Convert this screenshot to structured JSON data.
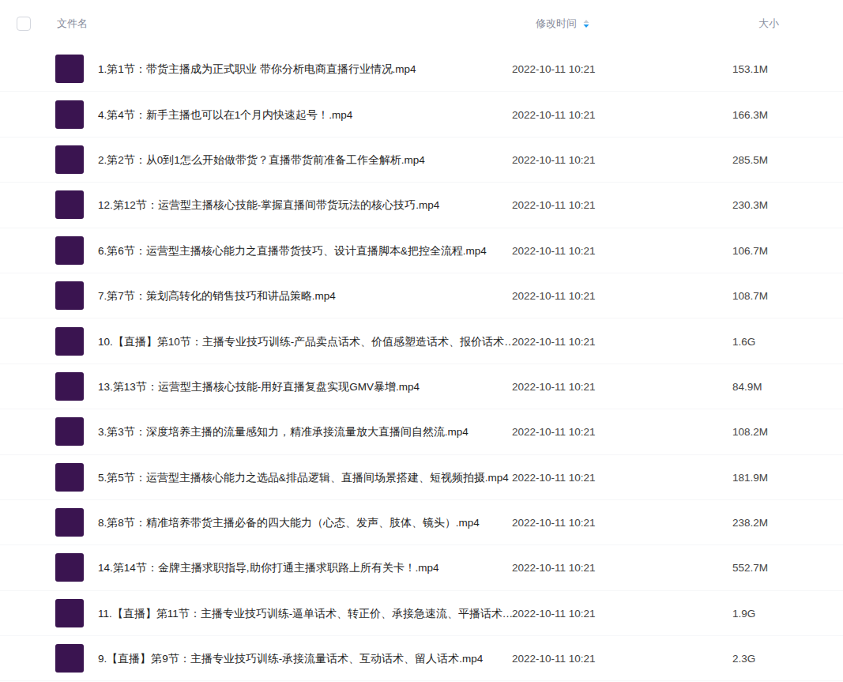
{
  "header": {
    "select_all": {
      "checked": false
    },
    "columns": [
      {
        "label": "文件名",
        "sorted": false
      },
      {
        "label": "修改时间",
        "sorted": true
      },
      {
        "label": "大小",
        "sorted": false
      }
    ]
  },
  "files": [
    {
      "name": "1.第1节：带货主播成为正式职业 带你分析电商直播行业情况.mp4",
      "modified": "2022-10-11 10:21",
      "size": "153.1M"
    },
    {
      "name": "4.第4节：新手主播也可以在1个月内快速起号！.mp4",
      "modified": "2022-10-11 10:21",
      "size": "166.3M"
    },
    {
      "name": "2.第2节：从0到1怎么开始做带货？直播带货前准备工作全解析.mp4",
      "modified": "2022-10-11 10:21",
      "size": "285.5M"
    },
    {
      "name": "12.第12节：运营型主播核心技能-掌握直播间带货玩法的核心技巧.mp4",
      "modified": "2022-10-11 10:21",
      "size": "230.3M"
    },
    {
      "name": "6.第6节：运营型主播核心能力之直播带货技巧、设计直播脚本&把控全流程.mp4",
      "modified": "2022-10-11 10:21",
      "size": "106.7M"
    },
    {
      "name": "7.第7节：策划高转化的销售技巧和讲品策略.mp4",
      "modified": "2022-10-11 10:21",
      "size": "108.7M"
    },
    {
      "name": "10.【直播】第10节：主播专业技巧训练-产品卖点话术、价值感塑造话术、报价话术…",
      "modified": "2022-10-11 10:21",
      "size": "1.6G"
    },
    {
      "name": "13.第13节：运营型主播核心技能-用好直播复盘实现GMV暴增.mp4",
      "modified": "2022-10-11 10:21",
      "size": "84.9M"
    },
    {
      "name": "3.第3节：深度培养主播的流量感知力，精准承接流量放大直播间自然流.mp4",
      "modified": "2022-10-11 10:21",
      "size": "108.2M"
    },
    {
      "name": "5.第5节：运营型主播核心能力之选品&排品逻辑、直播间场景搭建、短视频拍摄.mp4",
      "modified": "2022-10-11 10:21",
      "size": "181.9M"
    },
    {
      "name": "8.第8节：精准培养带货主播必备的四大能力（心态、发声、肢体、镜头）.mp4",
      "modified": "2022-10-11 10:21",
      "size": "238.2M"
    },
    {
      "name": "14.第14节：金牌主播求职指导,助你打通主播求职路上所有关卡！.mp4",
      "modified": "2022-10-11 10:21",
      "size": "552.7M"
    },
    {
      "name": "11.【直播】第11节：主播专业技巧训练-逼单话术、转正价、承接急速流、平播话术.…",
      "modified": "2022-10-11 10:21",
      "size": "1.9G"
    },
    {
      "name": "9.【直播】第9节：主播专业技巧训练-承接流量话术、互动话术、留人话术.mp4",
      "modified": "2022-10-11 10:21",
      "size": "2.3G"
    }
  ]
}
